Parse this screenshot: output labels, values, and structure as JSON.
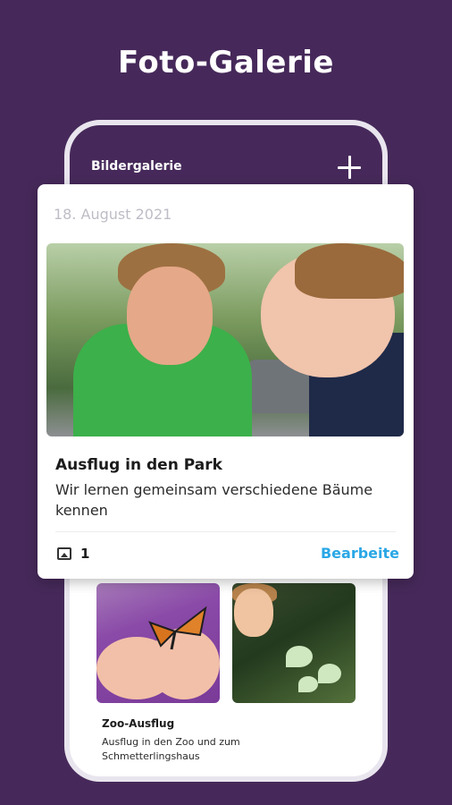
{
  "headline": "Foto-Galerie",
  "app": {
    "title": "Bildergalerie",
    "add_icon": "plus-icon"
  },
  "featured_card": {
    "date": "18. August 2021",
    "title": "Ausflug in den Park",
    "description": "Wir lernen gemeinsam verschiedene Bäume kennen",
    "image_count": "1",
    "edit_label": "Bearbeite"
  },
  "second_album": {
    "title": "Zoo-Ausflug",
    "description": "Ausflug in den Zoo und zum Schmetterlingshaus"
  },
  "colors": {
    "background": "#46295a",
    "accent_link": "#2aa7e6"
  }
}
